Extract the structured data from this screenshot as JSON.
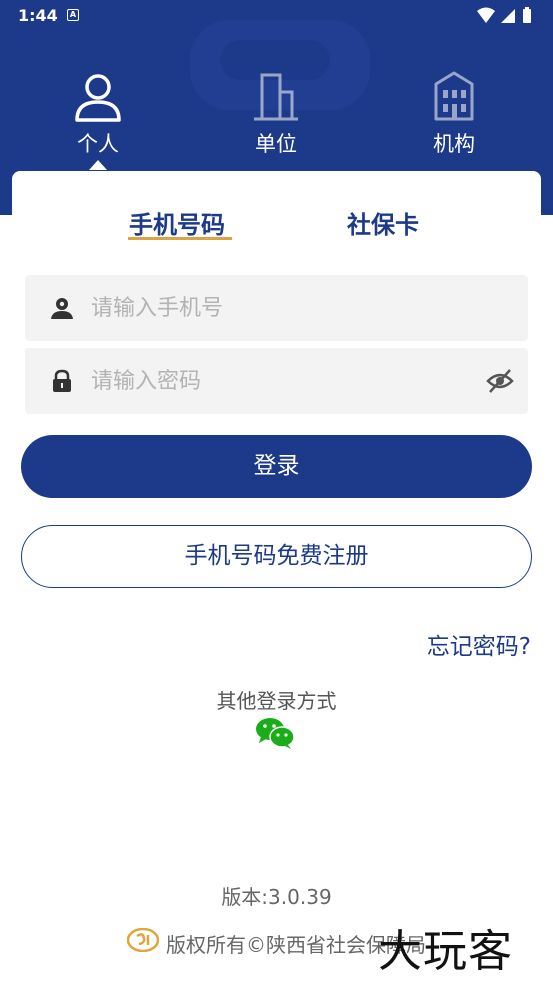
{
  "status_bar": {
    "time": "1:44",
    "notification_badge": "A"
  },
  "user_types": [
    {
      "label": "个人",
      "icon": "person-icon",
      "active": true
    },
    {
      "label": "单位",
      "icon": "building-icon",
      "active": false
    },
    {
      "label": "机构",
      "icon": "institution-icon",
      "active": false
    }
  ],
  "login_tabs": [
    {
      "label": "手机号码",
      "active": true
    },
    {
      "label": "社保卡",
      "active": false
    }
  ],
  "phone_field": {
    "placeholder": "请输入手机号",
    "value": "",
    "icon": "user-icon"
  },
  "password_field": {
    "placeholder": "请输入密码",
    "value": "",
    "icon": "lock-icon",
    "toggle_icon": "eye-off-icon"
  },
  "login_button": "登录",
  "register_button": "手机号码免费注册",
  "forgot_password": "忘记密码?",
  "other_login": {
    "label": "其他登录方式",
    "icon": "wechat-icon"
  },
  "version": "版本:3.0.39",
  "copyright": "版权所有©陕西省社会保障局",
  "watermark": "大玩客",
  "colors": {
    "primary": "#1d3a8a",
    "accent": "#d9a441",
    "wechat": "#1aad19",
    "field_bg": "#f3f3f3"
  }
}
